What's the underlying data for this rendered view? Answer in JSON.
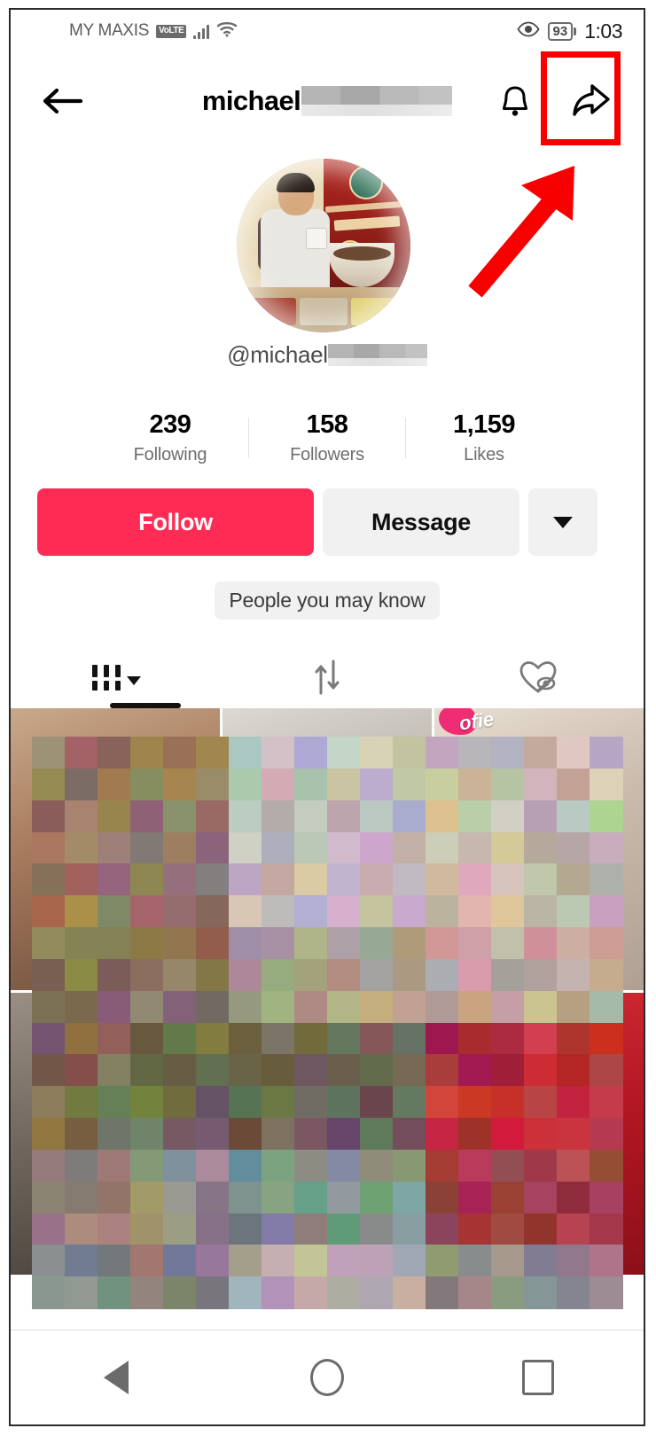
{
  "status_bar": {
    "carrier": "MY MAXIS",
    "volte_badge": "VoLTE",
    "signal_icon": "signal-bars-icon",
    "wifi_icon": "wifi-icon",
    "eye_icon": "eye-icon",
    "battery_level": "93",
    "time": "1:03"
  },
  "header": {
    "back_icon": "back-arrow-icon",
    "title": "michael",
    "title_redacted": true,
    "bell_icon": "bell-icon",
    "share_icon": "share-arrow-icon",
    "highlight_color": "#F80000"
  },
  "profile": {
    "avatar_alt": "man holding coffee cup beside durian white coffee poster",
    "handle": "@michael",
    "handle_redacted": true
  },
  "stats": [
    {
      "value": "239",
      "label": "Following"
    },
    {
      "value": "158",
      "label": "Followers"
    },
    {
      "value": "1,159",
      "label": "Likes"
    }
  ],
  "actions": {
    "follow_label": "Follow",
    "follow_color": "#FE2C55",
    "message_label": "Message",
    "more_icon": "chevron-down-icon",
    "suggestion_label": "People you may know"
  },
  "tabs": [
    {
      "name": "posts",
      "icon": "grid-icon",
      "active": true,
      "has_caret": true
    },
    {
      "name": "reposts",
      "icon": "repost-arrows-icon",
      "active": false
    },
    {
      "name": "liked",
      "icon": "heart-hidden-icon",
      "active": false
    }
  ],
  "video_grid": {
    "columns": 3,
    "rows": 2,
    "censored": true,
    "overlay_tag": "ofie"
  },
  "nav_bar": {
    "back_icon": "nav-back-triangle-icon",
    "home_icon": "nav-home-circle-icon",
    "recents_icon": "nav-recents-square-icon"
  }
}
